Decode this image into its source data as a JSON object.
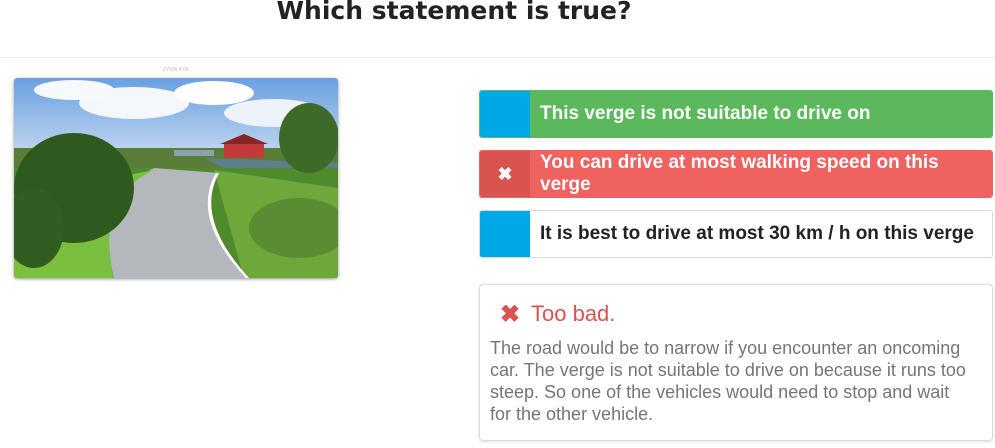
{
  "question": {
    "title": "Which statement is true?"
  },
  "image": {
    "alt_caption": "ZYXW 4:06"
  },
  "answers": [
    {
      "marker": "",
      "text": "This verge is not suitable to drive on",
      "state": "correct"
    },
    {
      "marker": "✖",
      "text": "You can drive at most walking speed on this verge",
      "state": "wrong-selected"
    },
    {
      "marker": "",
      "text": "It is best to drive at most 30 km / h on this verge",
      "state": "neutral"
    }
  ],
  "feedback": {
    "icon": "✖",
    "title": "Too bad.",
    "body": "The road would be to narrow if you encounter an oncoming car. The verge is not suitable to drive on because it runs too steep. So one of the vehicles would need to stop and wait for the other vehicle."
  },
  "colors": {
    "correct": "#5cb85c",
    "wrong": "#f0625f",
    "marker_blue": "#00a8e8",
    "wrong_marker": "#d9534f"
  }
}
